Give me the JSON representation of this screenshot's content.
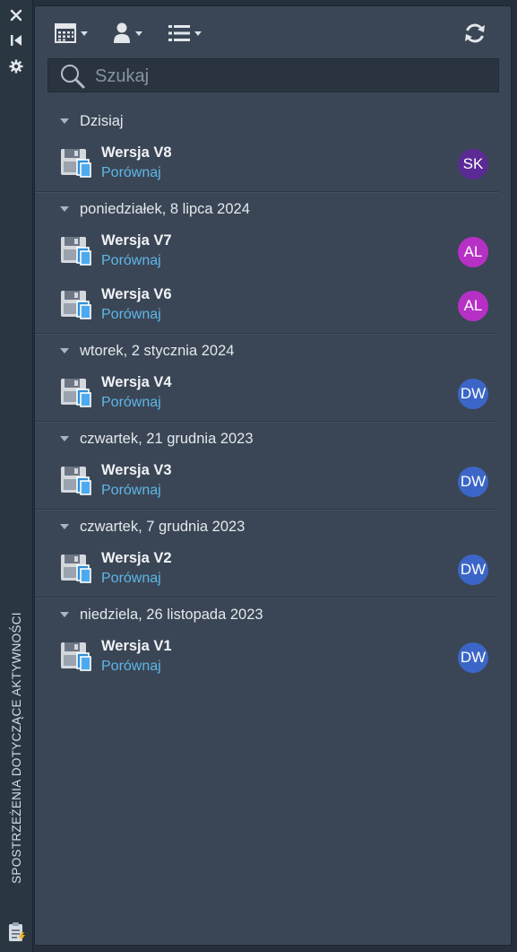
{
  "palette": {
    "panel_bg": "#3a4655",
    "side_strip_bg": "#2b3643",
    "link": "#5eb7ea"
  },
  "side_strip": {
    "icons": [
      "close-icon",
      "collapse-icon",
      "gear-icon"
    ],
    "title": "SPOSTRZEŻENIA DOTYCZĄCE AKTYWNOŚCI",
    "bottom_icon": "activity-clipboard-icon"
  },
  "toolbar": {
    "buttons": [
      {
        "icon": "calendar-filter-icon",
        "has_dropdown": true
      },
      {
        "icon": "user-filter-icon",
        "has_dropdown": true
      },
      {
        "icon": "list-view-icon",
        "has_dropdown": true
      },
      {
        "icon": "refresh-icon",
        "has_dropdown": false
      }
    ]
  },
  "search": {
    "placeholder": "Szukaj",
    "value": "",
    "icon": "search-icon"
  },
  "groups": [
    {
      "date": "Dzisiaj",
      "items": [
        {
          "title": "Wersja V8",
          "link": "Porównaj",
          "user": "SK",
          "user_color": "#5b2a94"
        }
      ]
    },
    {
      "date": "poniedziałek, 8 lipca 2024",
      "items": [
        {
          "title": "Wersja V7",
          "link": "Porównaj",
          "user": "AL",
          "user_color": "#b730c6"
        },
        {
          "title": "Wersja V6",
          "link": "Porównaj",
          "user": "AL",
          "user_color": "#b730c6"
        }
      ]
    },
    {
      "date": "wtorek, 2 stycznia 2024",
      "items": [
        {
          "title": "Wersja V4",
          "link": "Porównaj",
          "user": "DW",
          "user_color": "#3b66c7"
        }
      ]
    },
    {
      "date": "czwartek, 21 grudnia 2023",
      "items": [
        {
          "title": "Wersja V3",
          "link": "Porównaj",
          "user": "DW",
          "user_color": "#3b66c7"
        }
      ]
    },
    {
      "date": "czwartek, 7 grudnia 2023",
      "items": [
        {
          "title": "Wersja V2",
          "link": "Porównaj",
          "user": "DW",
          "user_color": "#3b66c7"
        }
      ]
    },
    {
      "date": "niedziela, 26 listopada 2023",
      "items": [
        {
          "title": "Wersja V1",
          "link": "Porównaj",
          "user": "DW",
          "user_color": "#3b66c7"
        }
      ]
    }
  ]
}
